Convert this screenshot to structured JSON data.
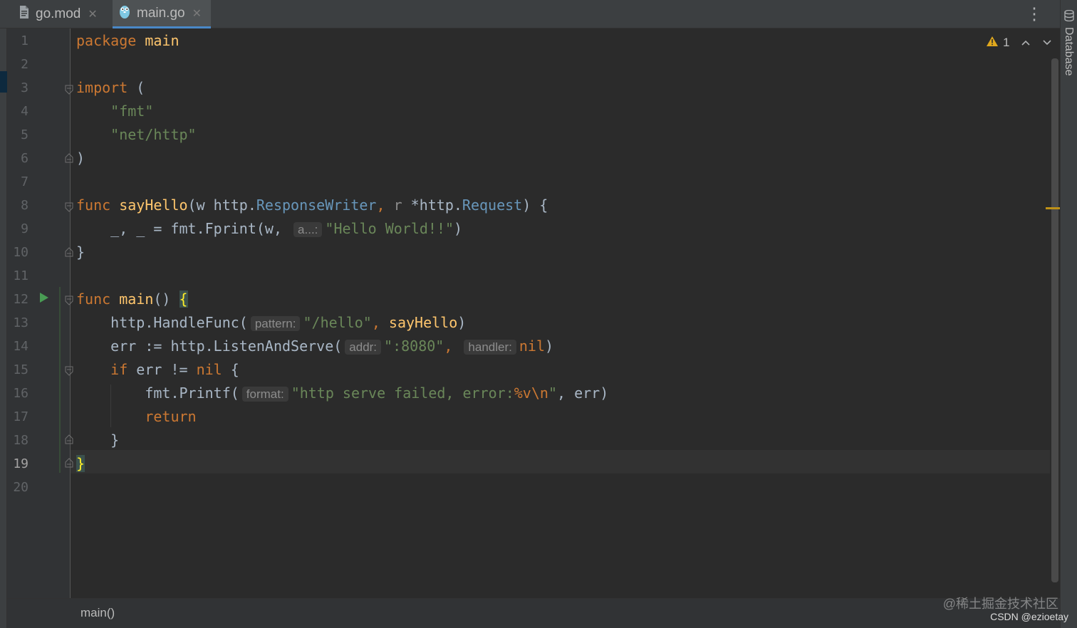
{
  "tabs": [
    {
      "name": "go.mod",
      "icon": "file-icon",
      "close": "✕",
      "active": false
    },
    {
      "name": "main.go",
      "icon": "gopher-icon",
      "close": "✕",
      "active": true
    }
  ],
  "right_sidebar": {
    "label": "Database",
    "icon": "database-icon"
  },
  "inspection": {
    "warning_count": "1",
    "icon": "warning-icon"
  },
  "line_numbers": [
    "1",
    "2",
    "3",
    "4",
    "5",
    "6",
    "7",
    "8",
    "9",
    "10",
    "11",
    "12",
    "13",
    "14",
    "15",
    "16",
    "17",
    "18",
    "19",
    "20"
  ],
  "current_line": "19",
  "code": {
    "l1": {
      "kw": "package",
      "name": "main"
    },
    "l3": {
      "kw": "import",
      "paren": "("
    },
    "l4": "\"fmt\"",
    "l5": "\"net/http\"",
    "l6": ")",
    "l8": {
      "kw": "func",
      "fn": "sayHello",
      "p1": "(w ",
      "pkg1": "http.",
      "t1": "ResponseWriter",
      "sep": ", ",
      "r": "r ",
      "star": "*http.",
      "t2": "Request",
      "end": ") {"
    },
    "l9": {
      "lhs": "_, _ = fmt.Fprint(w, ",
      "hint": "a...:",
      "str": "\"Hello World!!\"",
      "end": ")"
    },
    "l10": "}",
    "l12": {
      "kw": "func",
      "fn": "main",
      "paren": "() ",
      "brace": "{"
    },
    "l13": {
      "pre": "http.HandleFunc(",
      "hint": "pattern:",
      "str": "\"/hello\"",
      "sep": ", ",
      "fn": "sayHello",
      "end": ")"
    },
    "l14": {
      "pre": "err := http.ListenAndServe(",
      "hint1": "addr:",
      "str": "\":8080\"",
      "sep": ", ",
      "hint2": "handler:",
      "nil": "nil",
      "end": ")"
    },
    "l15": {
      "kw": "if",
      "mid": " err != ",
      "nil": "nil",
      "end": " {"
    },
    "l16": {
      "pre": "fmt.Printf(",
      "hint": "format:",
      "str": "\"http serve failed, error:",
      "fmtspec": "%v\\n",
      "strend": "\"",
      "end": ", err)"
    },
    "l17": "return",
    "l18": "}",
    "l19": "}"
  },
  "breadcrumb": "main()",
  "watermark": {
    "line1": "@稀土掘金技术社区",
    "line2": "CSDN @ezioetay"
  },
  "colors": {
    "keyword": "#cc7832",
    "function": "#ffc66d",
    "string": "#6a8759",
    "type": "#6897bb",
    "background": "#2b2b2b"
  }
}
